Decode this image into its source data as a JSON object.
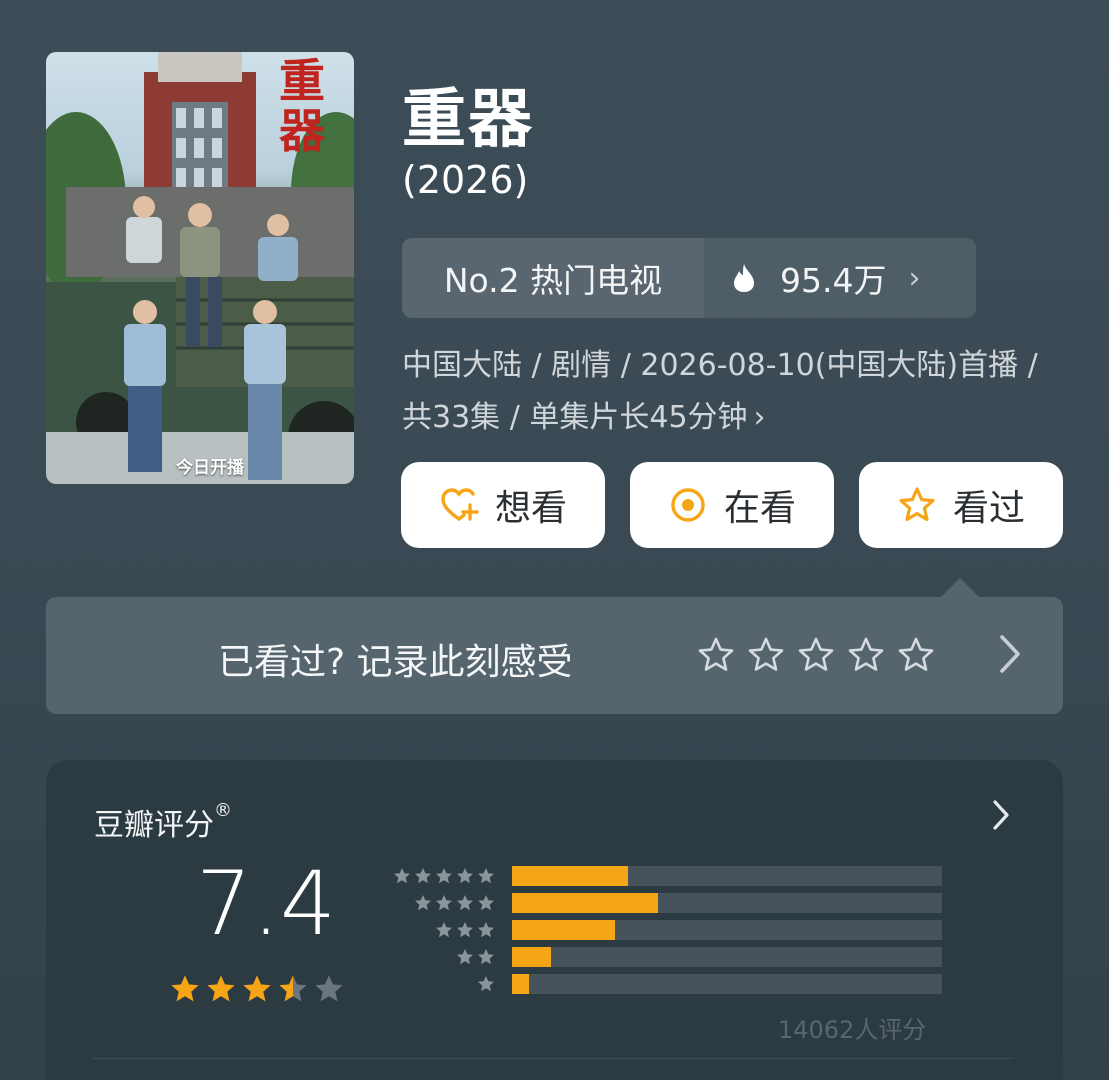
{
  "poster": {
    "title_art": "重器",
    "banner": "今日开播"
  },
  "header": {
    "title": "重器",
    "year": "(2026)"
  },
  "ranking": {
    "rank_label": "No.2 热门电视",
    "heat_value": "95.4万",
    "icon": "flame-icon"
  },
  "meta": {
    "line": "中国大陆 / 剧情 / 2026-08-10(中国大陆)首播 / 共33集 / 单集片长45分钟"
  },
  "actions": [
    {
      "label": "想看",
      "icon": "heart-plus-icon"
    },
    {
      "label": "在看",
      "icon": "target-circle-icon"
    },
    {
      "label": "看过",
      "icon": "star-outline-icon"
    }
  ],
  "record": {
    "prompt": "已看过? 记录此刻感受",
    "stars": 5
  },
  "rating": {
    "label": "豆瓣评分",
    "registered_mark": "®",
    "score": "7.4",
    "score_stars": 3.5,
    "distribution": [
      {
        "stars": 5,
        "fraction": 0.27
      },
      {
        "stars": 4,
        "fraction": 0.34
      },
      {
        "stars": 3,
        "fraction": 0.24
      },
      {
        "stars": 2,
        "fraction": 0.09
      },
      {
        "stars": 1,
        "fraction": 0.04
      }
    ],
    "count_text": "14062人评分"
  },
  "colors": {
    "accent_orange": "#f5a516",
    "background": "#3a4953",
    "card": "#2c3a42"
  }
}
